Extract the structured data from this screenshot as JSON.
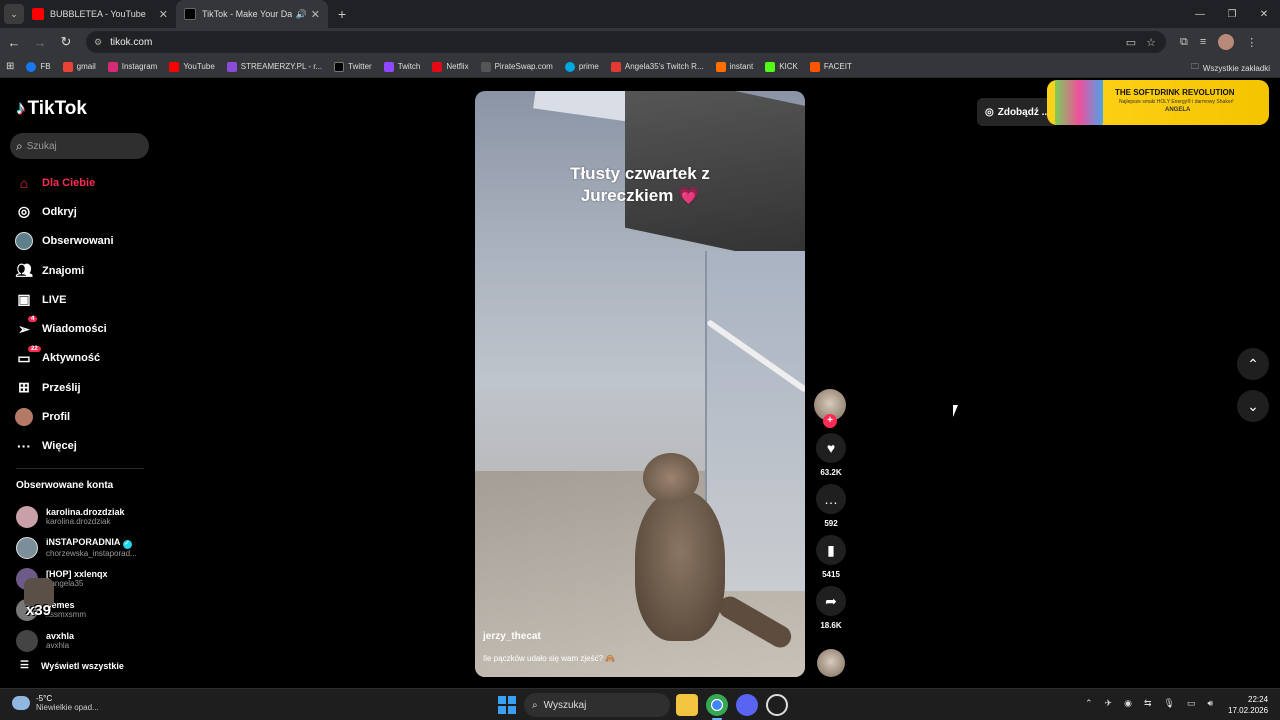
{
  "browser": {
    "tabs": [
      {
        "title": "BUBBLETEA - YouTube",
        "favicon_color": "#ff0000",
        "active": false
      },
      {
        "title": "TikTok - Make Your Day",
        "favicon_color": "#000000",
        "active": true
      }
    ],
    "url": "tikok.com",
    "bookmarks": [
      {
        "label": "FB",
        "color": "#1877f2"
      },
      {
        "label": "gmail",
        "color": "#ea4335"
      },
      {
        "label": "Instagram",
        "color": "#d62976"
      },
      {
        "label": "YouTube",
        "color": "#ff0000"
      },
      {
        "label": "STREAMERZY.PL - r...",
        "color": "#8a4bd6"
      },
      {
        "label": "Twitter",
        "color": "#000000"
      },
      {
        "label": "Twitch",
        "color": "#9146ff"
      },
      {
        "label": "Netflix",
        "color": "#e50914"
      },
      {
        "label": "PirateSwap.com",
        "color": "#555555"
      },
      {
        "label": "prime",
        "color": "#00a8e1"
      },
      {
        "label": "Angela35's Twitch R...",
        "color": "#e53935"
      },
      {
        "label": "instant",
        "color": "#ff6f00"
      },
      {
        "label": "KICK",
        "color": "#53fc18"
      },
      {
        "label": "FACEIT",
        "color": "#ff5500"
      }
    ],
    "all_bookmarks_label": "Wszystkie zakładki"
  },
  "tiktok": {
    "logo": "TikTok",
    "search_placeholder": "Szukaj",
    "nav": [
      {
        "label": "Dla Ciebie",
        "icon": "home-icon",
        "active": true
      },
      {
        "label": "Odkryj",
        "icon": "compass-icon"
      },
      {
        "label": "Obserwowani",
        "icon": "following-avatar-icon"
      },
      {
        "label": "Znajomi",
        "icon": "friends-icon"
      },
      {
        "label": "LIVE",
        "icon": "live-icon"
      },
      {
        "label": "Wiadomości",
        "icon": "messages-icon",
        "badge": "4"
      },
      {
        "label": "Aktywność",
        "icon": "activity-icon",
        "badge": "22"
      },
      {
        "label": "Prześlij",
        "icon": "upload-icon"
      },
      {
        "label": "Profil",
        "icon": "profile-avatar-icon"
      },
      {
        "label": "Więcej",
        "icon": "more-icon"
      }
    ],
    "following_title": "Obserwowane konta",
    "following": [
      {
        "name": "karolina.drozdziak",
        "handle": "karolina.drozdziak",
        "verified": false,
        "color": "#c9a0a8"
      },
      {
        "name": "iNSTAPORADNIA",
        "handle": "chorzewska_instaporad...",
        "verified": true,
        "color": "#7a8f9a"
      },
      {
        "name": "[HOP] xxlenqx",
        "handle": "t.angela35",
        "verified": false,
        "color": "#6e5a86"
      },
      {
        "name": "nemes",
        "handle": "xssmxsmm",
        "verified": false,
        "color": "#777777"
      },
      {
        "name": "avxhla",
        "handle": "avxhla",
        "verified": false,
        "color": "#444444"
      }
    ],
    "show_all": "Wyświetl wszystkie",
    "overlay_text": "x39",
    "video": {
      "caption_line1": "Tłusty czwartek z",
      "caption_line2": "Jureczkiem",
      "caption_emoji": "💗",
      "username": "jerzy_thecat",
      "description": "Ile pączków udało się wam zjeść? 🙈"
    },
    "actions": {
      "likes": "63.2K",
      "comments": "592",
      "saves": "5415",
      "shares": "18.6K"
    },
    "coins_button": "Zdobądź ...",
    "ad": {
      "headline": "THE SOFTDRINK REVOLUTION",
      "subline": "Najlepsze smaki HOLY Energy® i darmowy Shaker!",
      "name": "ANGELA"
    }
  },
  "taskbar": {
    "weather_temp": "-5°C",
    "weather_desc": "Niewielkie opad...",
    "search_placeholder": "Wyszukaj",
    "time": "22:24",
    "date": "17.02.2026"
  }
}
